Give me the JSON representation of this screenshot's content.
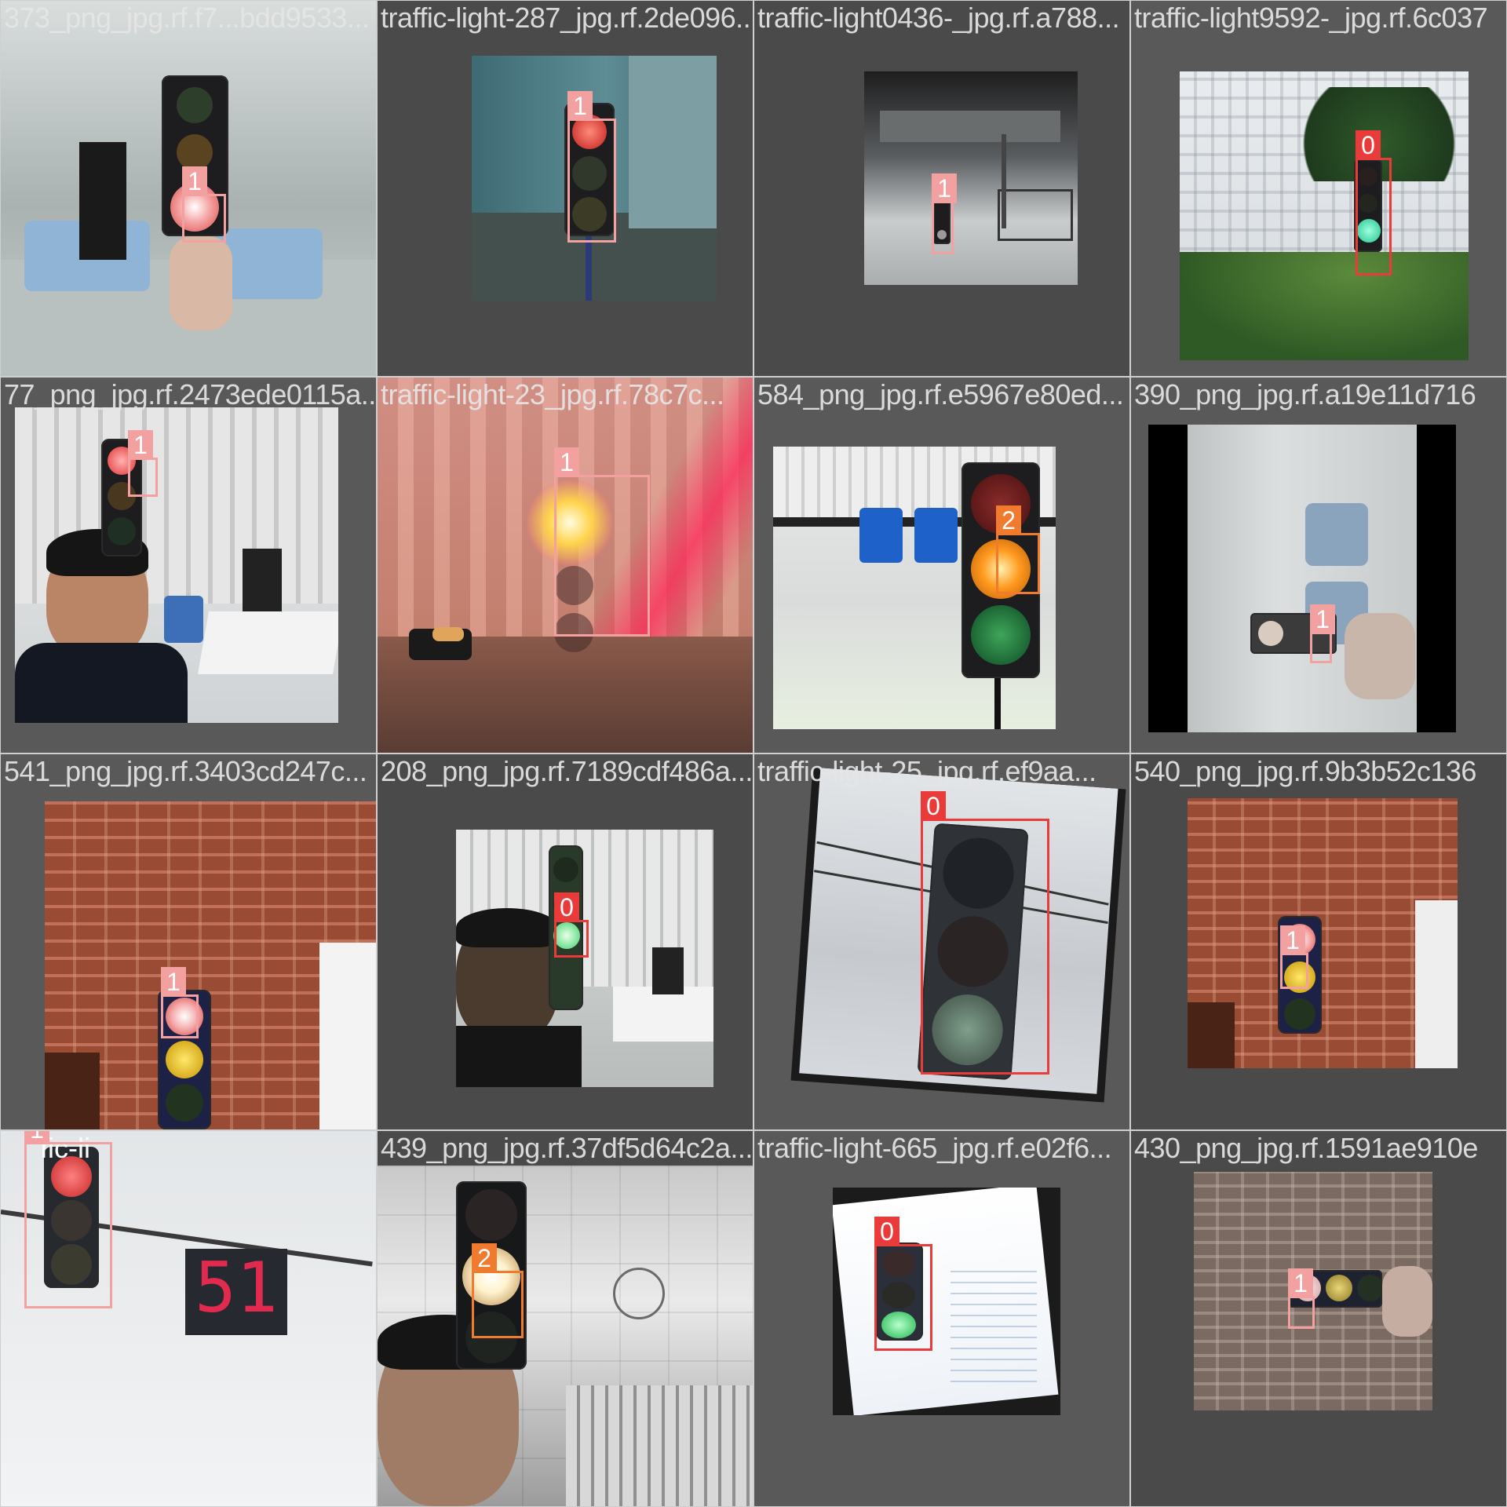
{
  "tiles": [
    {
      "filename": "373_png_jpg.rf.f7...bdd9533...",
      "labels": [
        "1"
      ]
    },
    {
      "filename": "traffic-light-287_jpg.rf.2de096...",
      "labels": [
        "1"
      ]
    },
    {
      "filename": "traffic-light0436-_jpg.rf.a788...",
      "labels": [
        "1"
      ]
    },
    {
      "filename": "traffic-light9592-_jpg.rf.6c037",
      "labels": [
        "0"
      ]
    },
    {
      "filename": "77_png_jpg.rf.2473ede0115a...",
      "labels": [
        "1"
      ]
    },
    {
      "filename": "traffic-light-23_jpg.rf.78c7c...",
      "labels": [
        "1"
      ]
    },
    {
      "filename": "584_png_jpg.rf.e5967e80ed...",
      "labels": [
        "2"
      ]
    },
    {
      "filename": "390_png_jpg.rf.a19e11d716",
      "labels": [
        "1"
      ]
    },
    {
      "filename": "541_png_jpg.rf.3403cd247c...",
      "labels": [
        "1"
      ]
    },
    {
      "filename": "208_png_jpg.rf.7189cdf486a...",
      "labels": [
        "0"
      ]
    },
    {
      "filename": "traffic-light-25_jpg.rf.ef9aa...",
      "labels": [
        "0"
      ]
    },
    {
      "filename": "540_png_jpg.rf.9b3b52c136",
      "labels": [
        "1"
      ]
    },
    {
      "filename": "",
      "labels": [
        "1"
      ],
      "sign_text": "fic-li",
      "countdown": "51"
    },
    {
      "filename": "439_png_jpg.rf.37df5d64c2a...",
      "labels": [
        "2"
      ]
    },
    {
      "filename": "traffic-light-665_jpg.rf.e02f6...",
      "labels": [
        "0"
      ]
    },
    {
      "filename": "430_png_jpg.rf.1591ae910e",
      "labels": [
        "1"
      ]
    }
  ],
  "colors": {
    "class0": "#ea3b3b",
    "class1": "#f2a0a0",
    "class2": "#f07a2e"
  }
}
